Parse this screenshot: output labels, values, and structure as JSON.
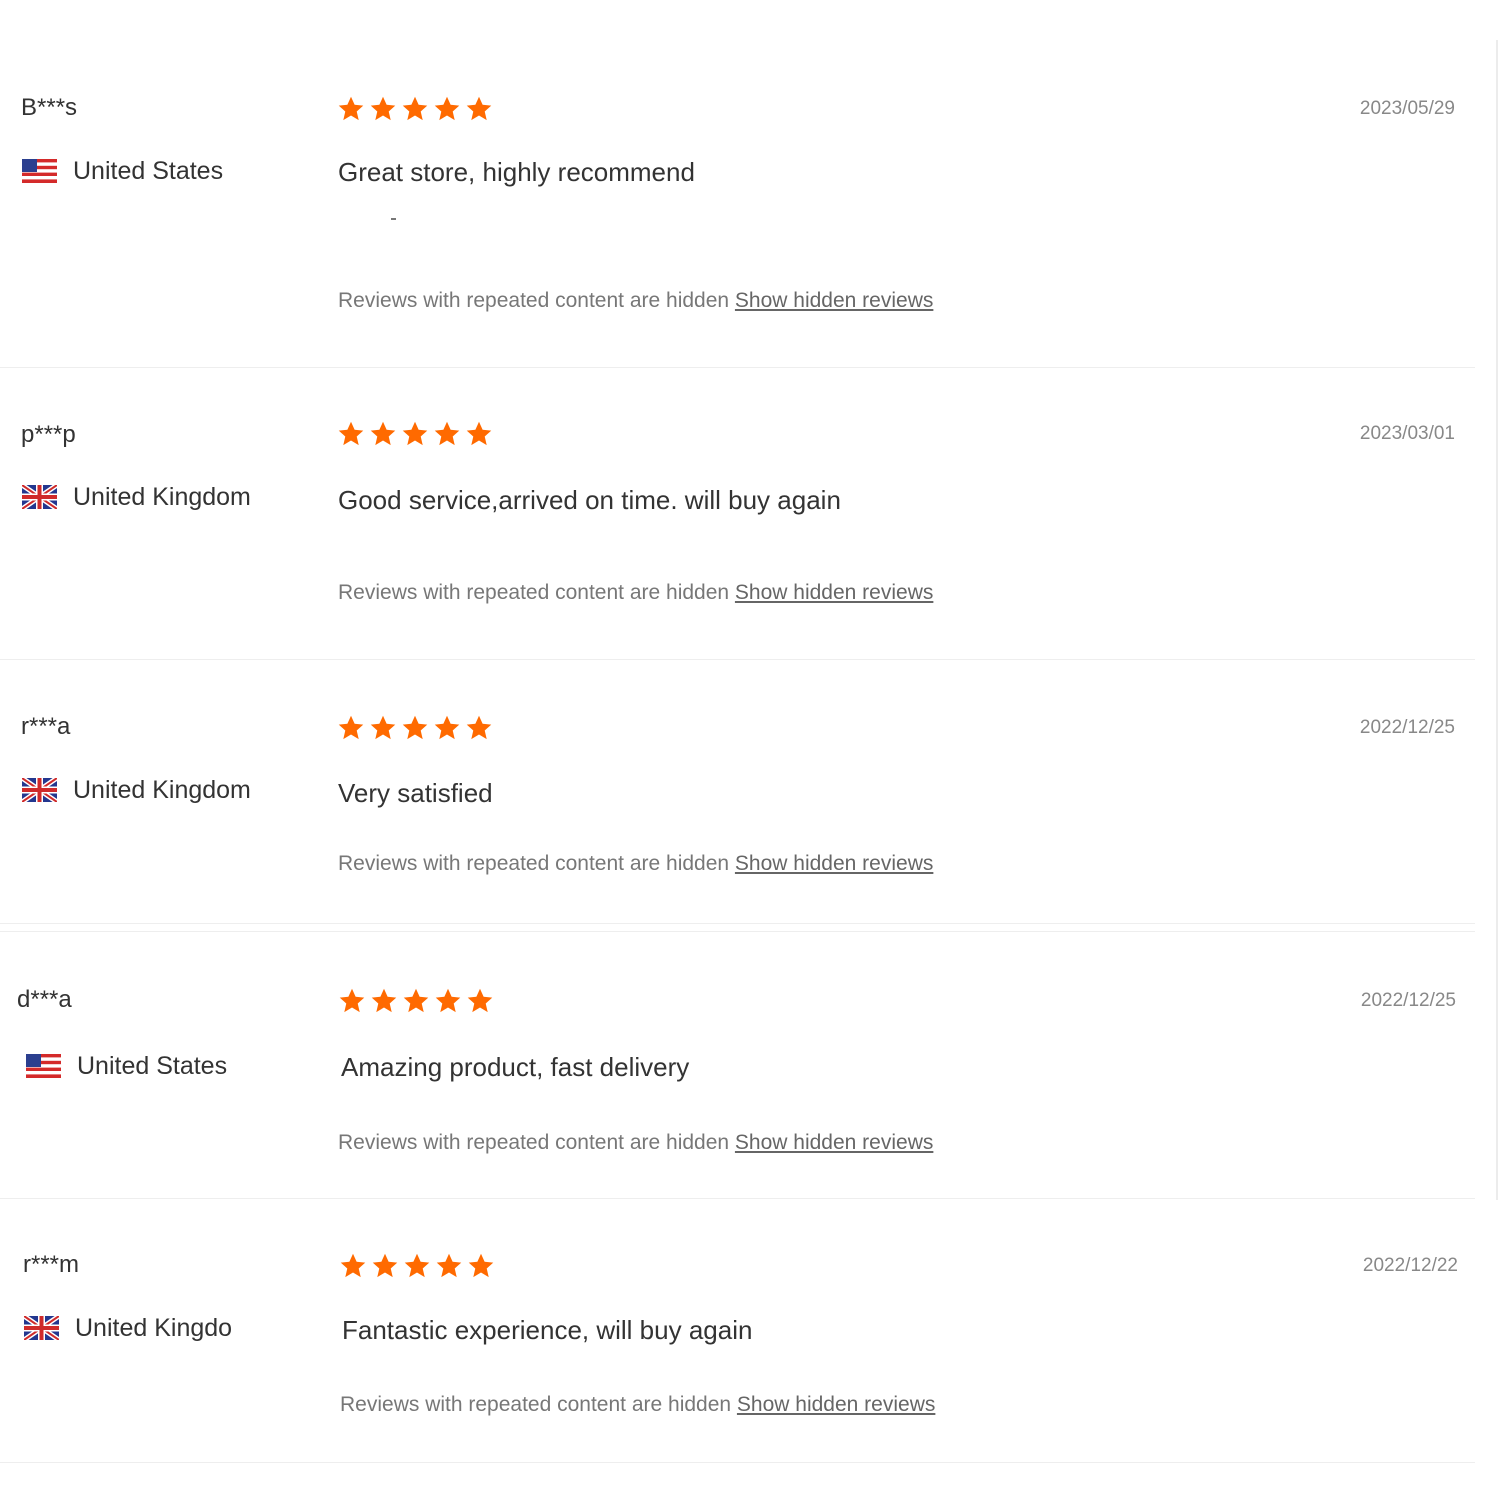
{
  "colors": {
    "star": "#ff6a00",
    "text": "#333333",
    "muted": "#777777"
  },
  "reviews": [
    {
      "user": "B***s",
      "country": "United States",
      "flag_icon": "us-flag-icon",
      "rating": 5,
      "date": "2023/05/29",
      "content": "Great store, highly recommend",
      "hidden_note": "Reviews with repeated content are hidden",
      "show_link": "Show hidden reviews"
    },
    {
      "user": "p***p",
      "country": "United Kingdom",
      "flag_icon": "uk-flag-icon",
      "rating": 5,
      "date": "2023/03/01",
      "content": "Good service,arrived on time. will buy again",
      "hidden_note": "Reviews with repeated content are hidden",
      "show_link": "Show hidden reviews"
    },
    {
      "user": "r***a",
      "country": "United Kingdom",
      "flag_icon": "uk-flag-icon",
      "rating": 5,
      "date": "2022/12/25",
      "content": "Very satisfied",
      "hidden_note": "Reviews with repeated content are hidden",
      "show_link": "Show hidden reviews"
    },
    {
      "user": "d***a",
      "country": "United States",
      "flag_icon": "us-flag-icon",
      "rating": 5,
      "date": "2022/12/25",
      "content": "Amazing product, fast delivery",
      "hidden_note": "Reviews with repeated content are hidden",
      "show_link": "Show hidden reviews"
    },
    {
      "user": "r***m",
      "country": "United Kingdo",
      "flag_icon": "uk-flag-icon",
      "rating": 5,
      "date": "2022/12/22",
      "content": "Fantastic experience, will buy again",
      "hidden_note": "Reviews with repeated content are hidden",
      "show_link": "Show hidden reviews"
    }
  ]
}
